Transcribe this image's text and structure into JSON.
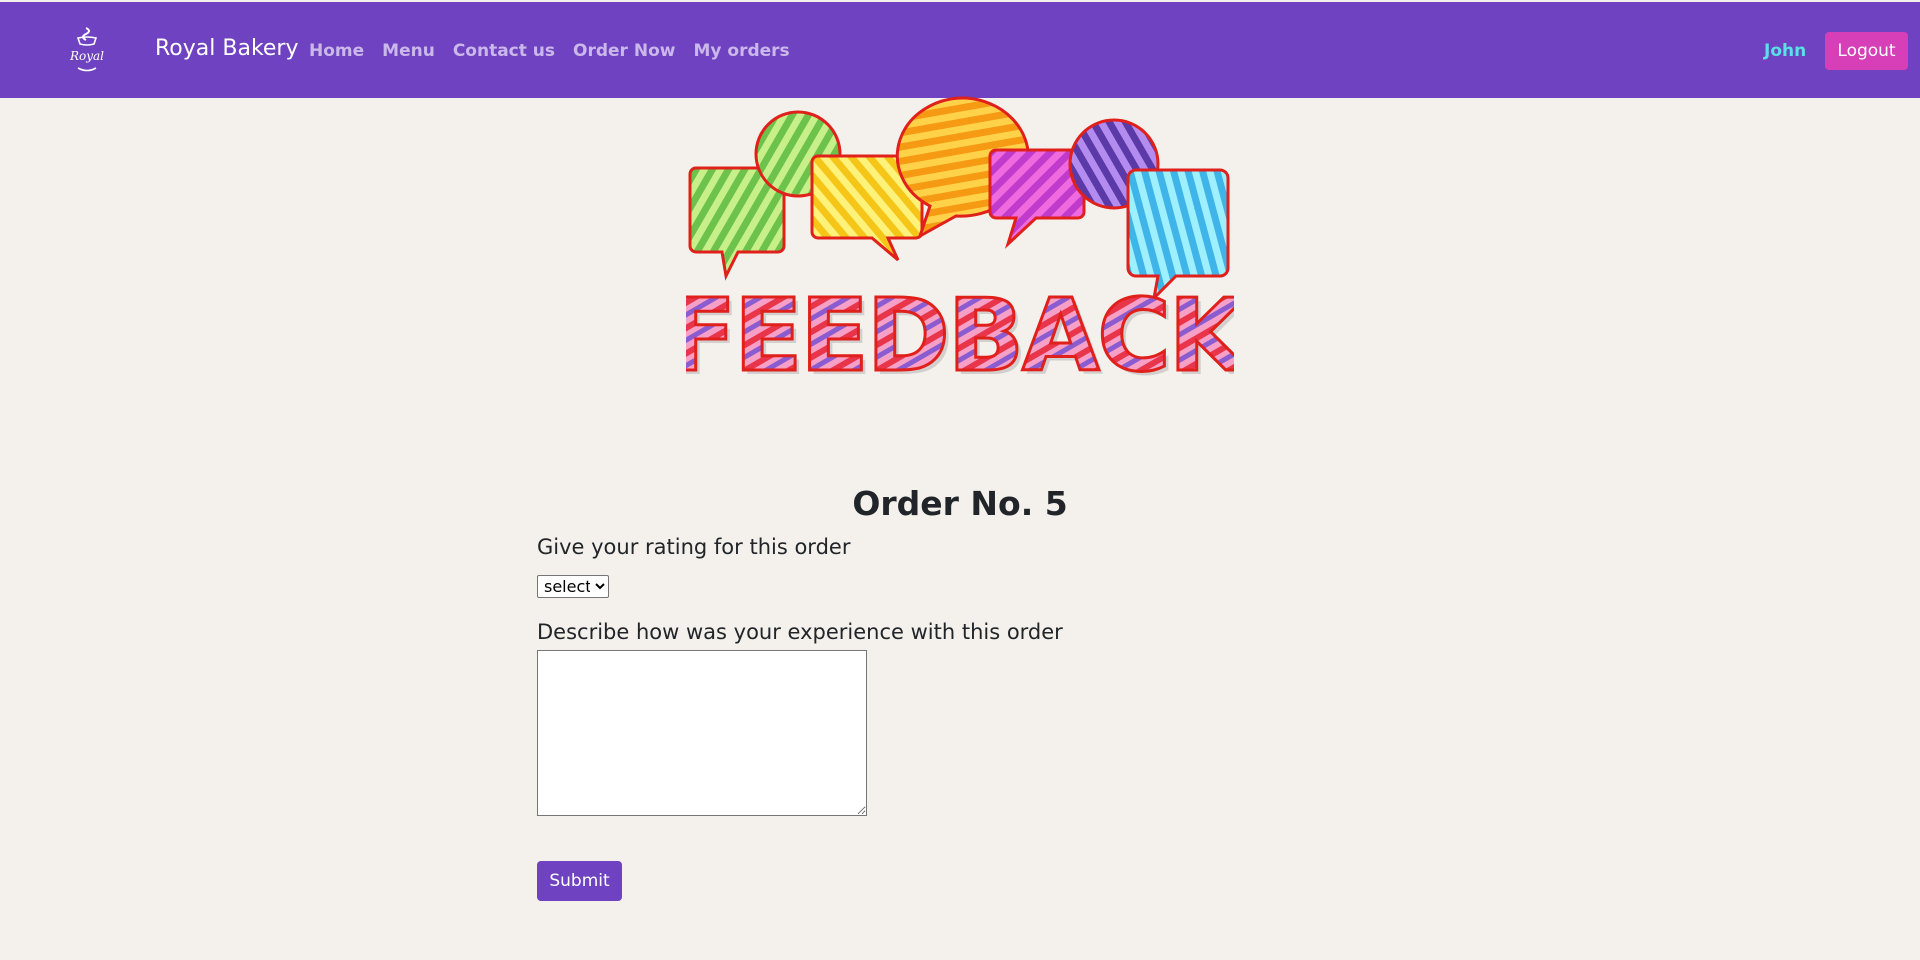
{
  "navbar": {
    "brand": "Royal Bakery",
    "logo_text": "Royal",
    "links": [
      {
        "label": "Home"
      },
      {
        "label": "Menu"
      },
      {
        "label": "Contact us"
      },
      {
        "label": "Order Now"
      },
      {
        "label": "My orders"
      }
    ],
    "user_name": "John",
    "logout_label": "Logout"
  },
  "banner": {
    "text": "FEEDBACK"
  },
  "form": {
    "title": "Order No. 5",
    "rating_label": "Give your rating for this order",
    "rating_select": {
      "selected": "select",
      "options": [
        "select"
      ]
    },
    "experience_label": "Describe how was your experience with this order",
    "experience_value": "",
    "submit_label": "Submit"
  },
  "colors": {
    "navbar_bg": "#6f42c1",
    "page_bg": "#f4f1ec",
    "logout_bg": "#d63fb7",
    "user_name": "#5be0e6",
    "submit_bg": "#6f42c1"
  }
}
